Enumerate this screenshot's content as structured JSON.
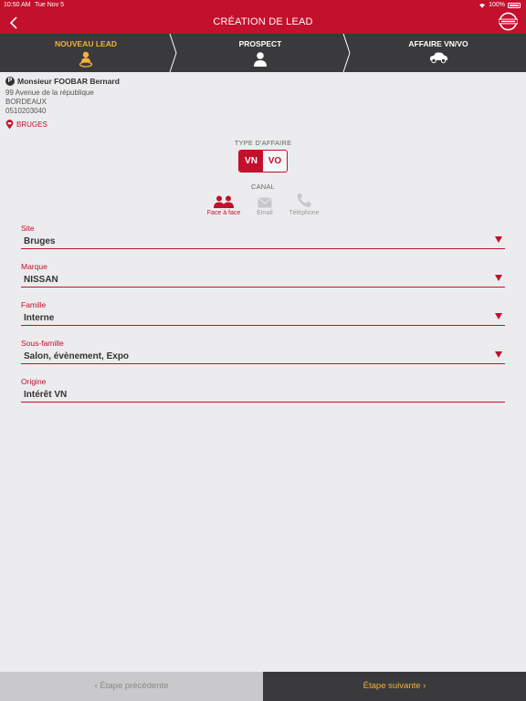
{
  "status": {
    "time": "10:50 AM",
    "date": "Tue Nov 5",
    "battery": "100%"
  },
  "header": {
    "title": "CRÉATION DE LEAD",
    "back_icon": "chevron-left-icon",
    "logo": "nissan-logo"
  },
  "steps": [
    {
      "label": "NOUVEAU LEAD",
      "icon": "location-person-icon"
    },
    {
      "label": "PROSPECT",
      "icon": "person-icon"
    },
    {
      "label": "AFFAIRE VN/VO",
      "icon": "car-icon"
    }
  ],
  "customer": {
    "badge": "P",
    "name": "Monsieur FOOBAR Bernard",
    "address1": "99 Avenue de la république",
    "city": "BORDEAUX",
    "phone": "0510203040",
    "dealer": "BRUGES"
  },
  "type_affaire": {
    "label": "TYPE D'AFFAIRE",
    "options": [
      "VN",
      "VO"
    ],
    "selected": "VN"
  },
  "canal": {
    "label": "CANAL",
    "options": [
      {
        "label": "Face à face",
        "icon": "people-icon"
      },
      {
        "label": "Email",
        "icon": "envelope-icon"
      },
      {
        "label": "Téléphone",
        "icon": "phone-icon"
      }
    ],
    "selected": "Face à face"
  },
  "fields": [
    {
      "label": "Site",
      "value": "Bruges"
    },
    {
      "label": "Marque",
      "value": "NISSAN"
    },
    {
      "label": "Famille",
      "value": "Interne"
    },
    {
      "label": "Sous-famille",
      "value": "Salon, évènement, Expo"
    },
    {
      "label": "Origine",
      "value": "Intérêt VN"
    }
  ],
  "footer": {
    "prev": "‹ Étape précédente",
    "next": "Étape suivante ›"
  },
  "colors": {
    "accent": "#c3102c",
    "active_step": "#f3b23b",
    "dark": "#3a3a3c",
    "background": "#ececee"
  }
}
